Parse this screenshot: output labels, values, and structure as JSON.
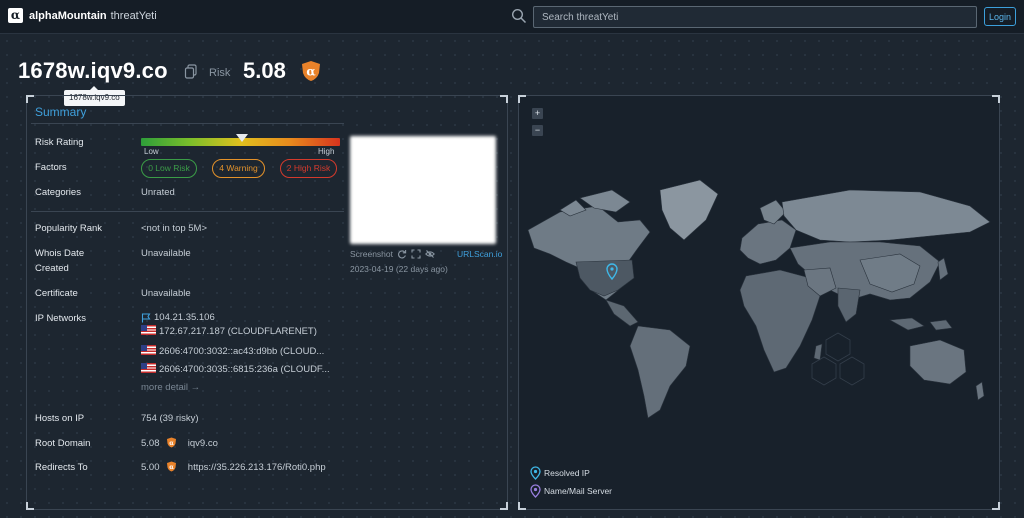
{
  "nav": {
    "brand": "alphaMountain",
    "product": "threatYeti",
    "search_placeholder": "Search threatYeti",
    "login_label": "Login"
  },
  "header": {
    "domain": "1678w.iqv9.co",
    "risk_label": "Risk",
    "risk_score": "5.08",
    "tooltip": "1678w.iqv9.co"
  },
  "summary": {
    "title": "Summary",
    "risk_rating": {
      "label": "Risk Rating",
      "low": "Low",
      "high": "High",
      "score_fraction": 0.508
    },
    "factors": {
      "label": "Factors",
      "low": "0 Low Risk",
      "warning": "4 Warning",
      "high": "2 High Risk"
    },
    "categories": {
      "label": "Categories",
      "value": "Unrated"
    },
    "popularity": {
      "label": "Popularity Rank",
      "value": "<not in top 5M>"
    },
    "whois": {
      "label_line1": "Whois Date",
      "label_line2": "Created",
      "value": "Unavailable"
    },
    "certificate": {
      "label": "Certificate",
      "value": "Unavailable"
    },
    "ip_networks": {
      "label": "IP Networks",
      "primary": "104.21.35.106",
      "items": [
        "172.67.217.187 (CLOUDFLARENET)",
        "2606:4700:3032::ac43:d9bb (CLOUD...",
        "2606:4700:3035::6815:236a (CLOUDF..."
      ],
      "more": "more detail →"
    },
    "hosts_on_ip": {
      "label": "Hosts on IP",
      "value": "754 (39 risky)"
    },
    "root_domain": {
      "label": "Root Domain",
      "score": "5.08",
      "value": "iqv9.co"
    },
    "redirects_to": {
      "label": "Redirects To",
      "score": "5.00",
      "value": "https://35.226.213.176/Roti0.php"
    }
  },
  "screenshot": {
    "label": "Screenshot",
    "source": "URLScan.io",
    "date": "2023-04-19 (22 days ago)"
  },
  "map": {
    "zoom_in": "+",
    "zoom_out": "−",
    "legend": {
      "resolved_ip": "Resolved IP",
      "name_mail": "Name/Mail Server"
    }
  },
  "colors": {
    "accent": "#3fa0dc",
    "low": "#3b9d47",
    "warning": "#e4922a",
    "high": "#d43a2c",
    "badge": "#e8822a"
  }
}
